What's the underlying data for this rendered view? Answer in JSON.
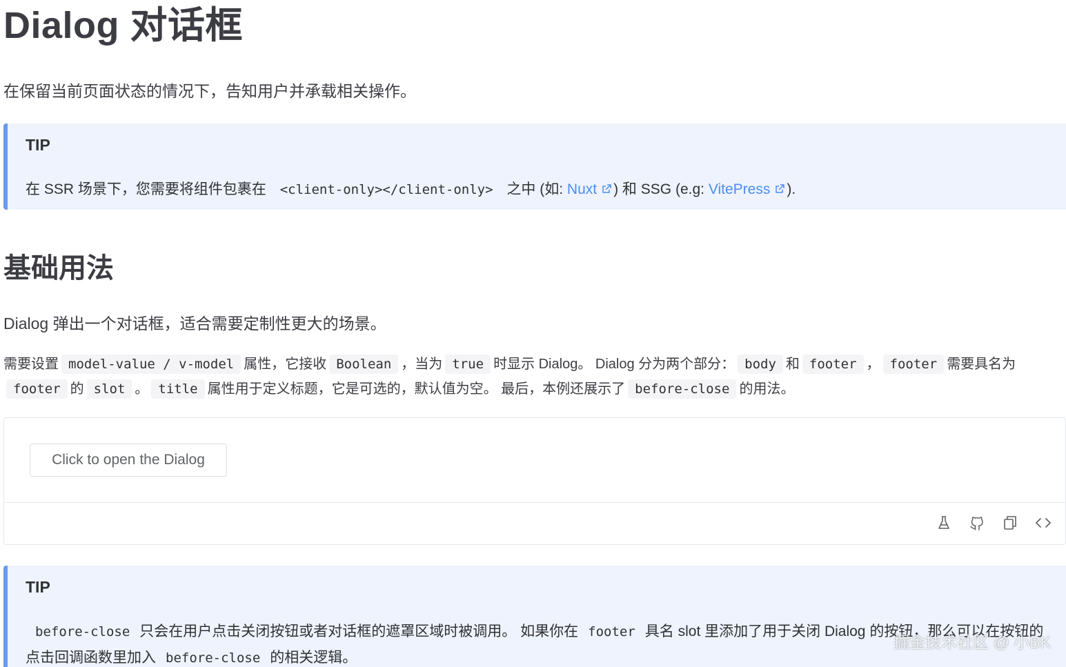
{
  "page": {
    "title": "Dialog 对话框",
    "intro": "在保留当前页面状态的情况下，告知用户并承载相关操作。"
  },
  "tip1": {
    "title": "TIP",
    "text_before": "在 SSR 场景下，您需要将组件包裹在",
    "code": "<client-only></client-only>",
    "text_mid": "之中 (如:",
    "link1": "Nuxt",
    "text_and": ") 和 SSG (e.g:",
    "link2": "VitePress",
    "text_end": ")."
  },
  "basic": {
    "title": "基础用法",
    "desc": "Dialog 弹出一个对话框，适合需要定制性更大的场景。",
    "p_1": "需要设置",
    "c_1": "model-value / v-model",
    "p_2": "属性，它接收",
    "c_2": "Boolean",
    "p_3": "，当为",
    "c_3": "true",
    "p_4": "时显示 Dialog。 Dialog 分为两个部分：",
    "c_4": "body",
    "p_5": "和",
    "c_5": "footer",
    "p_6": "，",
    "c_6": "footer",
    "p_7": "需要具名为",
    "c_7": "footer",
    "p_8": "的",
    "c_8": "slot",
    "p_9": "。",
    "c_9": "title",
    "p_10": "属性用于定义标题，它是可选的，默认值为空。 最后，本例还展示了",
    "c_10": "before-close",
    "p_11": "的用法。"
  },
  "demo": {
    "button_label": "Click to open the Dialog",
    "toolbar": [
      "playground-icon",
      "github-icon",
      "copy-icon",
      "code-icon"
    ]
  },
  "tip2": {
    "title": "TIP",
    "c_1": "before-close",
    "t_1": "只会在用户点击关闭按钮或者对话框的遮罩区域时被调用。 如果你在",
    "c_2": "footer",
    "t_2": "具名 slot 里添加了用于关闭 Dialog 的按钮，那么可以在按钮的点击回调函数里加入",
    "c_3": "before-close",
    "t_3": "的相关逻辑。"
  },
  "watermark": "掘金技术社区 @ 小BK",
  "colors": {
    "tip_bg": "#eef3fd",
    "tip_border": "#679ce8",
    "link": "#4b8ef1"
  }
}
